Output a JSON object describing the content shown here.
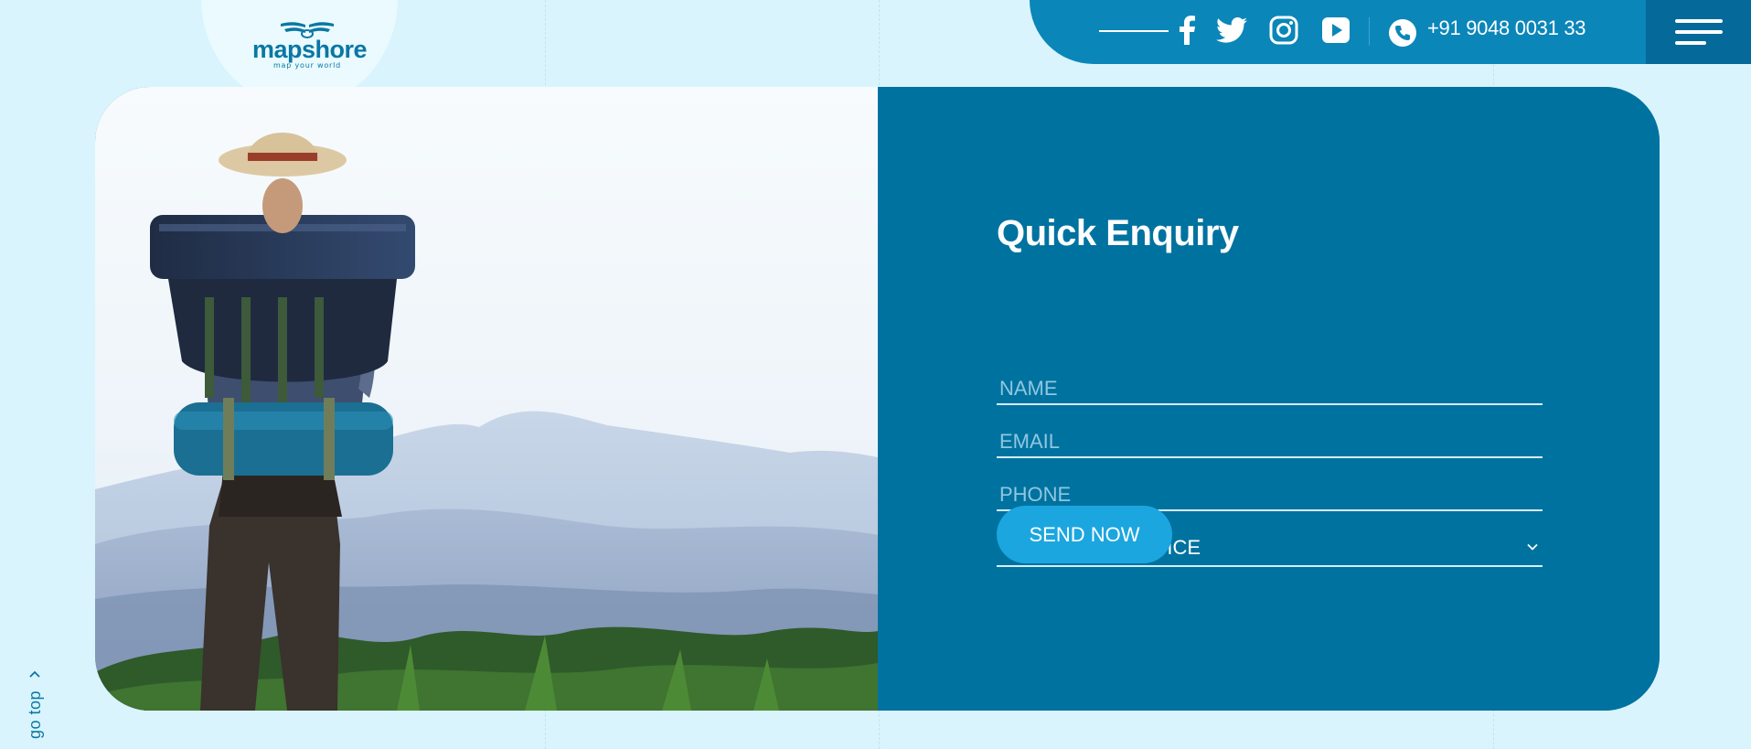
{
  "brand": {
    "name": "mapshore",
    "tagline": "map your world",
    "color": "#0a77a4"
  },
  "topbar": {
    "social": [
      "facebook-icon",
      "twitter-icon",
      "instagram-icon",
      "youtube-icon"
    ],
    "phone": "+91 9048 0031 33",
    "color": "#0b86b9"
  },
  "enquiry": {
    "title": "Quick Enquiry",
    "name_placeholder": "NAME",
    "email_placeholder": "EMAIL",
    "phone_placeholder": "PHONE",
    "service_selected": "CHOOSE A SERVICE",
    "submit_label": "SEND NOW",
    "panel_color": "#0072a0",
    "button_color": "#1ba6df"
  },
  "nav": {
    "go_top_label": "go top"
  }
}
